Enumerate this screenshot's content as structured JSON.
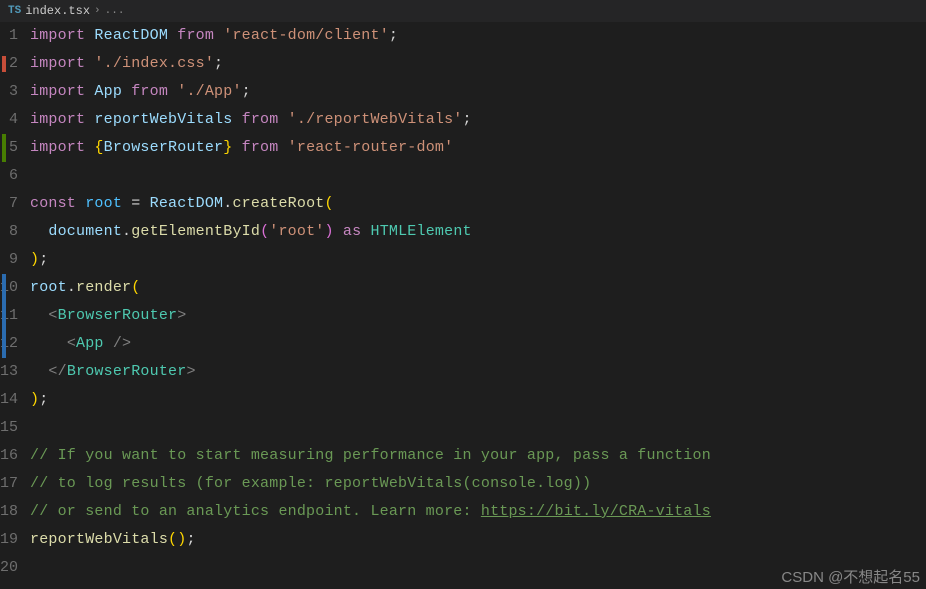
{
  "tab": {
    "icon_label": "TS",
    "filename": "index.tsx",
    "separator": "›",
    "rest": "..."
  },
  "gutter": {
    "start": 1,
    "count": 20,
    "decorations": [
      {
        "line": 2,
        "class": "deco-red",
        "height": 0.6
      },
      {
        "line": 5,
        "class": "deco-green",
        "height": 1
      },
      {
        "line": 11,
        "class": "deco-blue",
        "height": 3
      }
    ]
  },
  "code": {
    "lines": [
      [
        {
          "c": "tok-key",
          "t": "import"
        },
        {
          "c": "",
          "t": " "
        },
        {
          "c": "tok-var",
          "t": "ReactDOM"
        },
        {
          "c": "",
          "t": " "
        },
        {
          "c": "tok-key",
          "t": "from"
        },
        {
          "c": "",
          "t": " "
        },
        {
          "c": "tok-str",
          "t": "'react-dom/client'"
        },
        {
          "c": "tok-pun",
          "t": ";"
        }
      ],
      [
        {
          "c": "tok-key",
          "t": "import"
        },
        {
          "c": "",
          "t": " "
        },
        {
          "c": "tok-str",
          "t": "'./index.css'"
        },
        {
          "c": "tok-pun",
          "t": ";"
        }
      ],
      [
        {
          "c": "tok-key",
          "t": "import"
        },
        {
          "c": "",
          "t": " "
        },
        {
          "c": "tok-var",
          "t": "App"
        },
        {
          "c": "",
          "t": " "
        },
        {
          "c": "tok-key",
          "t": "from"
        },
        {
          "c": "",
          "t": " "
        },
        {
          "c": "tok-str",
          "t": "'./App'"
        },
        {
          "c": "tok-pun",
          "t": ";"
        }
      ],
      [
        {
          "c": "tok-key",
          "t": "import"
        },
        {
          "c": "",
          "t": " "
        },
        {
          "c": "tok-var",
          "t": "reportWebVitals"
        },
        {
          "c": "",
          "t": " "
        },
        {
          "c": "tok-key",
          "t": "from"
        },
        {
          "c": "",
          "t": " "
        },
        {
          "c": "tok-str",
          "t": "'./reportWebVitals'"
        },
        {
          "c": "tok-pun",
          "t": ";"
        }
      ],
      [
        {
          "c": "tok-key",
          "t": "import"
        },
        {
          "c": "",
          "t": " "
        },
        {
          "c": "tok-brkY",
          "t": "{"
        },
        {
          "c": "tok-var",
          "t": "BrowserRouter"
        },
        {
          "c": "tok-brkY",
          "t": "}"
        },
        {
          "c": "",
          "t": " "
        },
        {
          "c": "tok-key",
          "t": "from"
        },
        {
          "c": "",
          "t": " "
        },
        {
          "c": "tok-str",
          "t": "'react-router-dom'"
        }
      ],
      [],
      [
        {
          "c": "tok-key",
          "t": "const"
        },
        {
          "c": "",
          "t": " "
        },
        {
          "c": "tok-var2",
          "t": "root"
        },
        {
          "c": "",
          "t": " "
        },
        {
          "c": "tok-pun",
          "t": "="
        },
        {
          "c": "",
          "t": " "
        },
        {
          "c": "tok-var",
          "t": "ReactDOM"
        },
        {
          "c": "tok-pun",
          "t": "."
        },
        {
          "c": "tok-fn",
          "t": "createRoot"
        },
        {
          "c": "tok-brkY",
          "t": "("
        }
      ],
      [
        {
          "c": "",
          "t": "  "
        },
        {
          "c": "tok-var",
          "t": "document"
        },
        {
          "c": "tok-pun",
          "t": "."
        },
        {
          "c": "tok-fn",
          "t": "getElementById"
        },
        {
          "c": "tok-brkP",
          "t": "("
        },
        {
          "c": "tok-str",
          "t": "'root'"
        },
        {
          "c": "tok-brkP",
          "t": ")"
        },
        {
          "c": "",
          "t": " "
        },
        {
          "c": "tok-key",
          "t": "as"
        },
        {
          "c": "",
          "t": " "
        },
        {
          "c": "tok-obj",
          "t": "HTMLElement"
        }
      ],
      [
        {
          "c": "tok-brkY",
          "t": ")"
        },
        {
          "c": "tok-pun",
          "t": ";"
        }
      ],
      [
        {
          "c": "tok-var",
          "t": "root"
        },
        {
          "c": "tok-pun",
          "t": "."
        },
        {
          "c": "tok-fn",
          "t": "render"
        },
        {
          "c": "tok-brkY",
          "t": "("
        }
      ],
      [
        {
          "c": "",
          "t": "  "
        },
        {
          "c": "tok-tag",
          "t": "<"
        },
        {
          "c": "tok-obj",
          "t": "BrowserRouter"
        },
        {
          "c": "tok-tag",
          "t": ">"
        }
      ],
      [
        {
          "c": "",
          "t": "    "
        },
        {
          "c": "tok-tag",
          "t": "<"
        },
        {
          "c": "tok-obj",
          "t": "App"
        },
        {
          "c": "",
          "t": " "
        },
        {
          "c": "tok-tag",
          "t": "/>"
        }
      ],
      [
        {
          "c": "",
          "t": "  "
        },
        {
          "c": "tok-tag",
          "t": "</"
        },
        {
          "c": "tok-obj",
          "t": "BrowserRouter"
        },
        {
          "c": "tok-tag",
          "t": ">"
        }
      ],
      [
        {
          "c": "tok-brkY",
          "t": ")"
        },
        {
          "c": "tok-pun",
          "t": ";"
        }
      ],
      [],
      [
        {
          "c": "tok-cmt",
          "t": "// If you want to start measuring performance in your app, pass a function"
        }
      ],
      [
        {
          "c": "tok-cmt",
          "t": "// to log results (for example: reportWebVitals(console.log))"
        }
      ],
      [
        {
          "c": "tok-cmt",
          "t": "// or send to an analytics endpoint. Learn more: "
        },
        {
          "c": "tok-link",
          "t": "https://bit.ly/CRA-vitals"
        }
      ],
      [
        {
          "c": "tok-fn",
          "t": "reportWebVitals"
        },
        {
          "c": "tok-brkY",
          "t": "("
        },
        {
          "c": "tok-brkY",
          "t": ")"
        },
        {
          "c": "tok-pun",
          "t": ";"
        }
      ],
      []
    ]
  },
  "watermark": "CSDN @不想起名55"
}
